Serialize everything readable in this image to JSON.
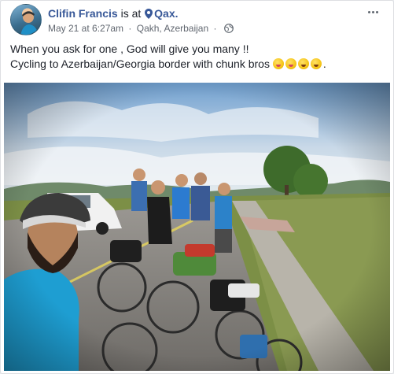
{
  "post": {
    "author": "Clifin Francis",
    "connector": "is at",
    "place": "Qax.",
    "date": "May 21 at 6:27am",
    "separator": "·",
    "location": "Qakh, Azerbaijan",
    "audience_icon": "globe-icon",
    "line1": "When you ask for one , God will give you many !!",
    "line2": "Cycling to Azerbaijan/Georgia border with chunk bros",
    "line2_end": ".",
    "emojis": [
      "squinting-tongue-emoji",
      "squinting-tongue-emoji",
      "grinning-emoji",
      "grinning-emoji"
    ]
  },
  "colors": {
    "link": "#385898",
    "meta": "#616770",
    "text": "#1d2129",
    "sky": "#9cc1e3",
    "grass": "#7c8f46",
    "road": "#8c8a86"
  },
  "photo": {
    "description_hidden": ""
  }
}
